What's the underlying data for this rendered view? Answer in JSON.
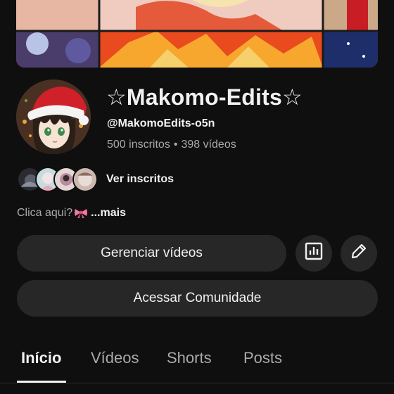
{
  "channel": {
    "name": "☆Makomo-Edits☆",
    "handle": "@MakomoEdits-o5n",
    "subscribers": "500 inscritos",
    "separator": "•",
    "videos": "398 vídeos"
  },
  "subscribers_preview": {
    "label": "Ver inscritos"
  },
  "description": {
    "text": "Clica aqui?",
    "emoji_icon": "ribbon-bow-icon",
    "more_label": "...mais"
  },
  "actions": {
    "manage_label": "Gerenciar vídeos",
    "stats_icon": "analytics-icon",
    "edit_icon": "pencil-icon",
    "community_label": "Acessar Comunidade"
  },
  "tabs": [
    {
      "label": "Início",
      "active": true
    },
    {
      "label": "Vídeos",
      "active": false
    },
    {
      "label": "Shorts",
      "active": false
    },
    {
      "label": "Posts",
      "active": false
    }
  ],
  "colors": {
    "background": "#0f0f0f",
    "button_bg": "#272727",
    "text_primary": "#f1f1f1",
    "text_secondary": "#aaaaaa",
    "santa_hat_red": "#d0202a"
  }
}
